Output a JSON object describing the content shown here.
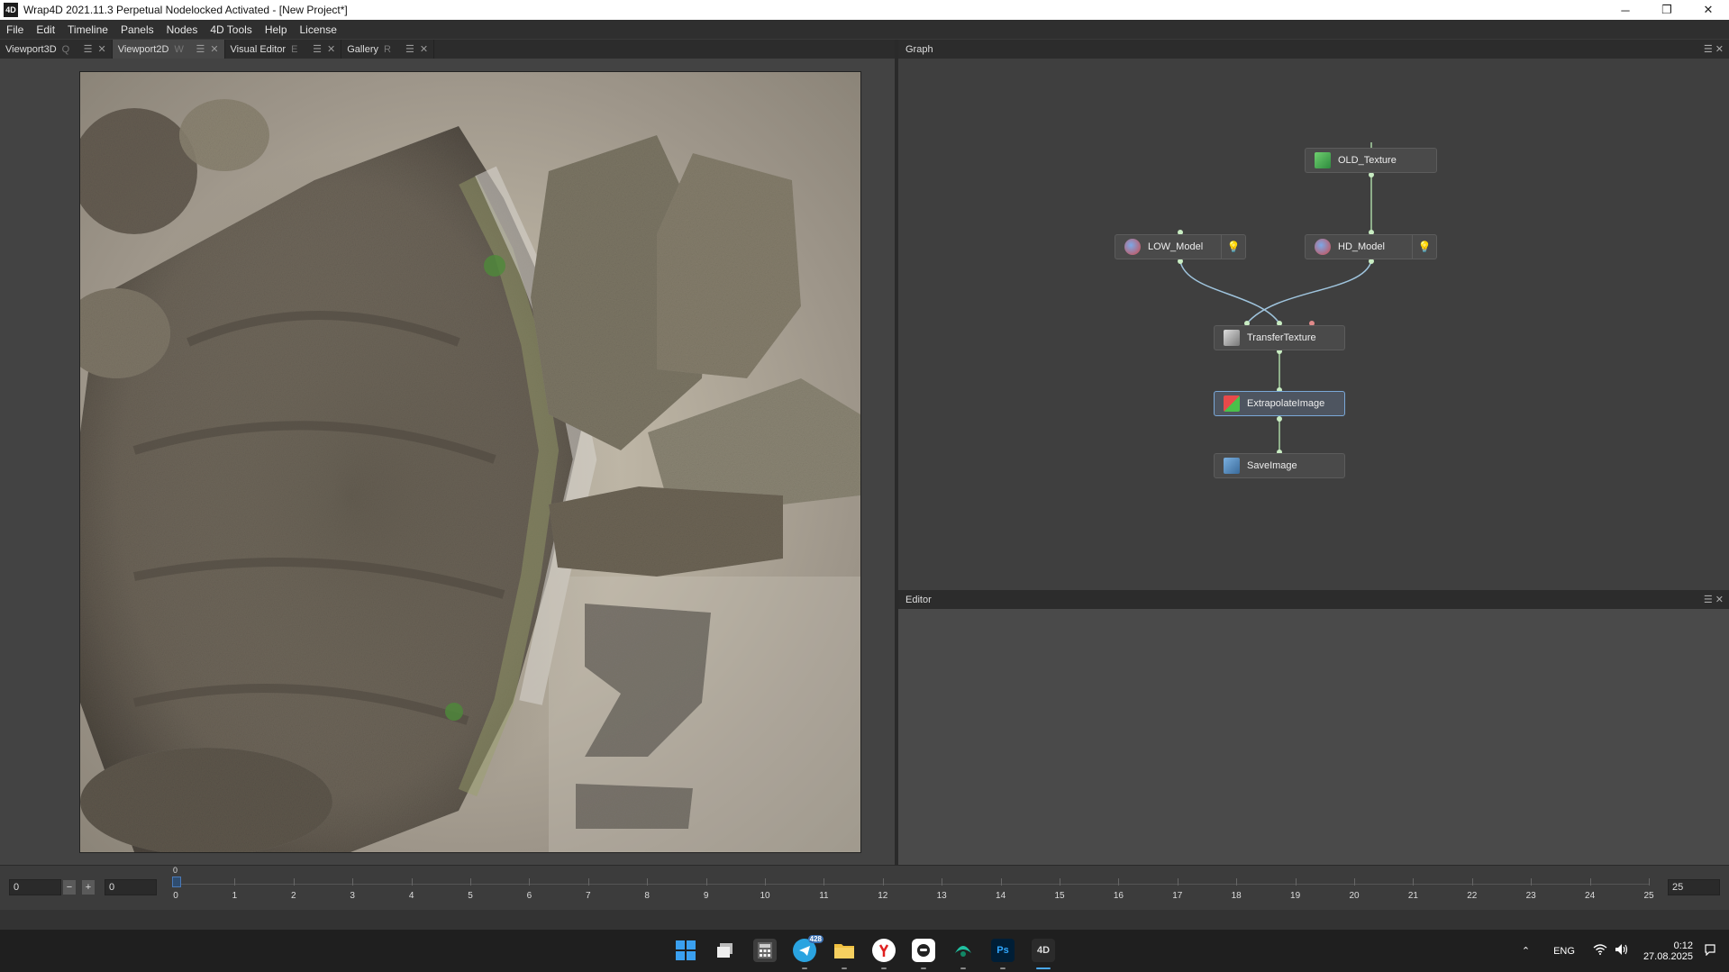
{
  "window": {
    "app_icon_text": "4D",
    "title": "Wrap4D 2021.11.3  Perpetual Nodelocked Activated  - [New Project*]",
    "controls": [
      "─",
      "❐",
      "✕"
    ]
  },
  "menubar": [
    "File",
    "Edit",
    "Timeline",
    "Panels",
    "Nodes",
    "4D Tools",
    "Help",
    "License"
  ],
  "left_tabs": [
    {
      "label": "Viewport3D",
      "key": "Q"
    },
    {
      "label": "Viewport2D",
      "key": "W"
    },
    {
      "label": "Visual Editor",
      "key": "E"
    },
    {
      "label": "Gallery",
      "key": "R"
    }
  ],
  "graph": {
    "title": "Graph",
    "nodes": [
      {
        "label": "OLD_Texture",
        "icon": "image-icon"
      },
      {
        "label": "LOW_Model",
        "icon": "model-icon"
      },
      {
        "label": "HD_Model",
        "icon": "model-icon"
      },
      {
        "label": "TransferTexture",
        "icon": "transfer-icon"
      },
      {
        "label": "ExtrapolateImage",
        "icon": "extrapolate-icon"
      },
      {
        "label": "SaveImage",
        "icon": "save-image-icon"
      }
    ]
  },
  "editor": {
    "title": "Editor"
  },
  "timeline": {
    "start_value": "0",
    "current_value": "0",
    "end_value": "25",
    "marker_label": "0",
    "ticks": [
      "0",
      "1",
      "2",
      "3",
      "4",
      "5",
      "6",
      "7",
      "8",
      "9",
      "10",
      "11",
      "12",
      "13",
      "14",
      "15",
      "16",
      "17",
      "18",
      "19",
      "20",
      "21",
      "22",
      "23",
      "24",
      "25"
    ]
  },
  "taskbar": {
    "apps": [
      "start-icon",
      "task-view-icon",
      "calculator-icon",
      "telegram-icon",
      "file-explorer-icon",
      "yandex-browser-icon",
      "messenger-icon",
      "wrap-icon",
      "photoshop-icon",
      "wrap4d-icon"
    ],
    "ps_label": "Ps",
    "w4d_label": "4D",
    "badge": "428",
    "lang": "ENG",
    "time": "0:12",
    "date": "27.08.2025"
  },
  "colors": {
    "accent": "#7aa8d8",
    "edge": "#a9d3a3",
    "edge_blue": "#9fc4dd",
    "port_red": "#e08a8a"
  }
}
